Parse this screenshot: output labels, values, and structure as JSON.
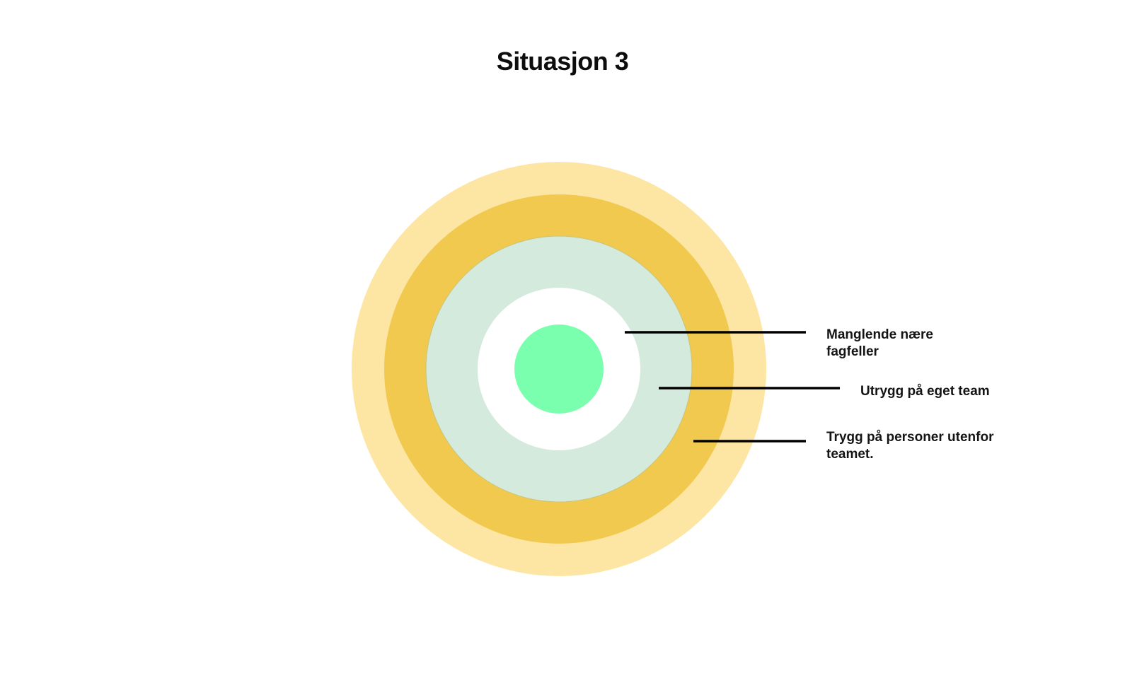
{
  "title": "Situasjon 3",
  "colors": {
    "outer_ring": "#FDE6A4",
    "middle_ring": "#F1C94E",
    "inner_ring": "#D4EADC",
    "inner_ring_stroke": "#C9C47C",
    "gap": "#FFFFFF",
    "core": "#7AFFAF",
    "line": "#000000"
  },
  "labels": [
    {
      "text": "Manglende nære\nfagfeller"
    },
    {
      "text": "Utrygg på eget team"
    },
    {
      "text": "Trygg på personer utenfor\nteamet."
    }
  ]
}
